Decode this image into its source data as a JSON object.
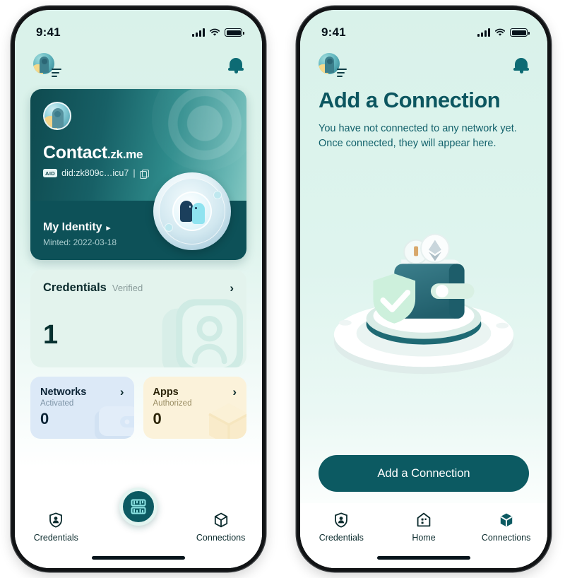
{
  "status_bar": {
    "time": "9:41"
  },
  "home_screen": {
    "header": {
      "brand_icon": "profile-avatar-logo",
      "bell_icon": "bell-icon"
    },
    "identity_card": {
      "name": "Contact",
      "name_suffix": ".zk.me",
      "aid_badge": "AID",
      "did": "did:zk809c…icu7",
      "did_separator": "|",
      "copy_icon": "copy-icon",
      "footer_label": "My Identity",
      "footer_caret": "▸",
      "minted": "Minted: 2022-03-18"
    },
    "credentials_card": {
      "title": "Credentials",
      "subtitle": "Verified",
      "count": "1",
      "chevron": "›"
    },
    "stats": [
      {
        "title": "Networks",
        "subtitle": "Activated",
        "count": "0",
        "chevron": "›",
        "icon": "wallet-icon"
      },
      {
        "title": "Apps",
        "subtitle": "Authorized",
        "count": "0",
        "chevron": "›",
        "icon": "cube-icon"
      }
    ],
    "tabbar": {
      "left": {
        "label": "Credentials",
        "icon": "shield-person-icon"
      },
      "center": {
        "label": "",
        "icon": "qr-scan-icon"
      },
      "right": {
        "label": "Connections",
        "icon": "cube-node-icon"
      }
    }
  },
  "connections_screen": {
    "header": {
      "brand_icon": "profile-avatar-logo",
      "bell_icon": "bell-icon"
    },
    "title": "Add a Connection",
    "description_line1": "You have not connected to any network yet.",
    "description_line2": "Once connected, they will appear here.",
    "illustration": "3d-wallet-on-podium-with-shield-check",
    "cta_label": "Add a Connection",
    "tabbar": {
      "left": {
        "label": "Credentials",
        "icon": "shield-person-icon"
      },
      "center": {
        "label": "Home",
        "icon": "home-icon"
      },
      "right": {
        "label": "Connections",
        "icon": "cube-node-icon"
      }
    }
  },
  "colors": {
    "brand_dark": "#0c5a62",
    "brand_teal": "#0d6b74",
    "screen_bg": "#d9f2ea",
    "card_gradient_start": "#0e4a4f",
    "card_gradient_end": "#8fcfc8",
    "credentials_bg": "#e3f3ed",
    "networks_bg": "#dce9f7",
    "apps_bg": "#fbf2da"
  }
}
